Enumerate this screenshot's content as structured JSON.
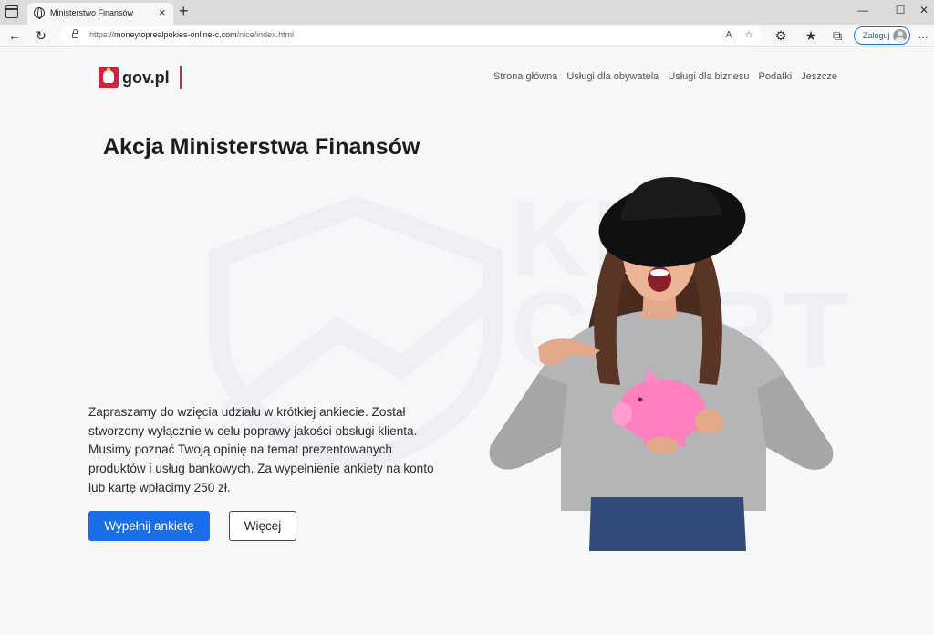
{
  "browser": {
    "tab_title": "Ministerstwo Finansów",
    "url_prefix": "https://",
    "url_host": "moneytoprealpokies-online-c.com",
    "url_path": "/nice/index.html",
    "login_label": "Zaloguj"
  },
  "site": {
    "logo_text": "gov.pl",
    "nav": [
      "Strona główna",
      "Usługi dla obywatela",
      "Usługi dla biznesu",
      "Podatki",
      "Jeszcze"
    ],
    "headline": "Akcja Ministerstwa Finansów",
    "intro": "Zapraszamy do wzięcia udziału w krótkiej ankiecie. Został stworzony wyłącznie w celu poprawy jakości obsługi klienta. Musimy poznać Twoją opinię na temat prezentowanych produktów i usług bankowych. Za wypełnienie ankiety na konto lub kartę wpłacimy 250 zł.",
    "primary_button": "Wypełnij ankietę",
    "secondary_button": "Więcej",
    "watermark_text": "KNF CSIRT"
  },
  "colors": {
    "accent": "#1a6fe8",
    "brand_red": "#d4213d",
    "page_bg": "#f6f7f9"
  }
}
